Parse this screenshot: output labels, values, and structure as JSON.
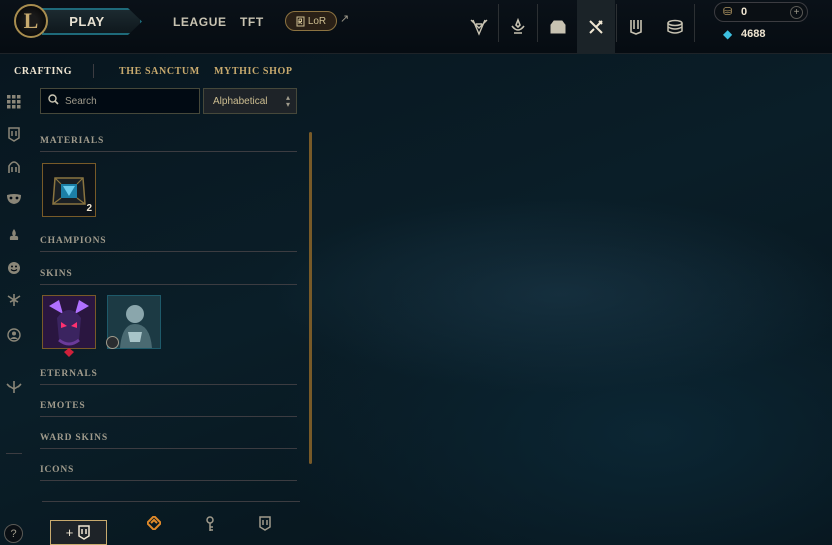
{
  "header": {
    "logo_glyph": "L",
    "play_label": "PLAY",
    "nav": [
      "LEAGUE",
      "TFT"
    ],
    "lor_label": "LoR",
    "external_icon": "↗",
    "icons": [
      "worlds-icon",
      "honor-icon",
      "loot-icon",
      "crafting-icon",
      "collection-icon",
      "store-icon"
    ],
    "rp_value": "0",
    "be_value": "4688"
  },
  "subnav": {
    "items": [
      "CRAFTING",
      "THE SANCTUM",
      "MYTHIC SHOP"
    ]
  },
  "panel": {
    "search_placeholder": "Search",
    "sort_label": "Alphabetical",
    "sections": {
      "materials": "MATERIALS",
      "champions": "CHAMPIONS",
      "skins": "SKINS",
      "eternals": "ETERNALS",
      "emotes": "EMOTES",
      "ward_skins": "WARD SKINS",
      "icons": "ICONS"
    },
    "materials_count": "2"
  },
  "colors": {
    "gold": "#c8aa6e",
    "teal": "#1e6a7a",
    "blue_essence": "#3dc0e0",
    "bg": "#010a13"
  },
  "help_label": "?"
}
